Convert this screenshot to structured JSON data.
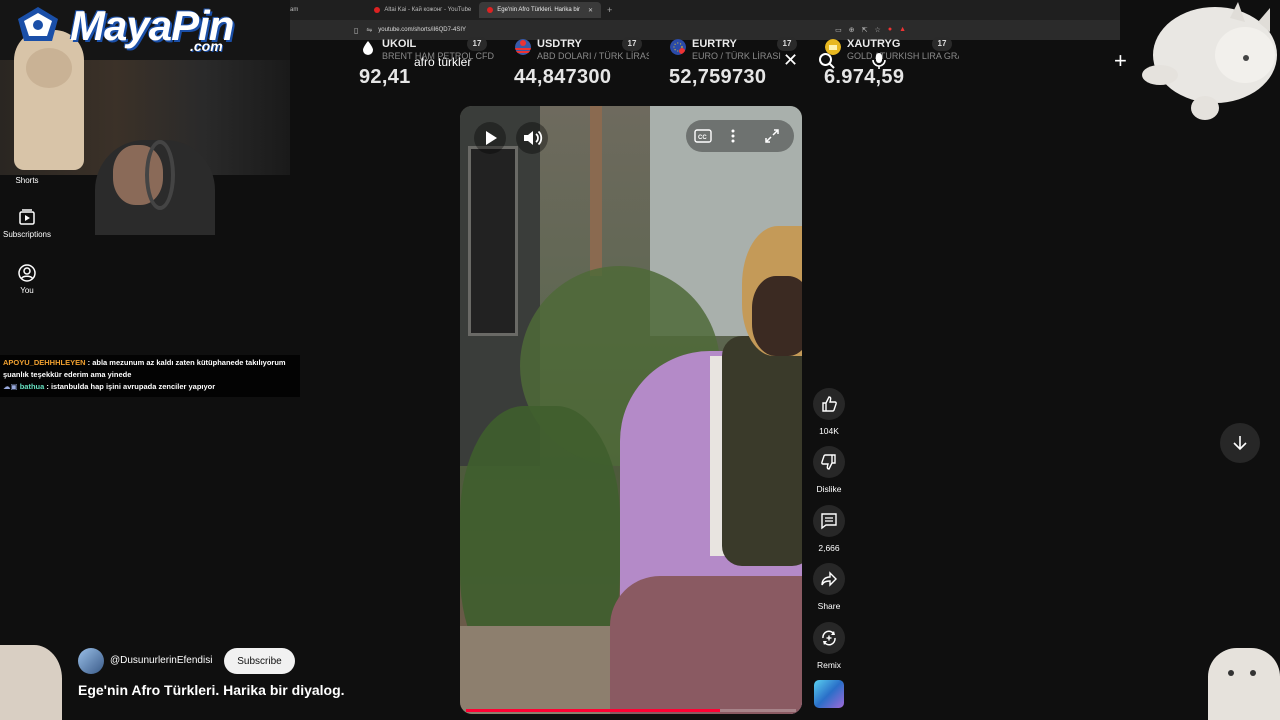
{
  "browser": {
    "tabs": [
      {
        "label": "ram",
        "active": false
      },
      {
        "label": "Altai Kai - Кай кожонг - YouTube",
        "active": false
      },
      {
        "label": "Ege'nin Afro Türkleri. Harika bir",
        "active": true
      }
    ],
    "url": "youtube.com/shorts/iI6QD7-4SIY"
  },
  "ticker": [
    {
      "symbol": "UKOIL",
      "desc": "BRENT HAM PETROL CFD'L",
      "value": "92,41"
    },
    {
      "symbol": "USDTRY",
      "desc": "ABD DOLARI / TÜRK LİRAS",
      "value": "44,847300"
    },
    {
      "symbol": "EURTRY",
      "desc": "EURO / TÜRK LİRASI",
      "value": "52,759730"
    },
    {
      "symbol": "XAUTRYG",
      "desc": "GOLD / TURKISH LIRA GRA",
      "value": "6.974,59"
    }
  ],
  "ticker_badge": "17",
  "search": {
    "query": "afro türkler"
  },
  "logo": {
    "main_white": "Maya",
    "main_blue": "Pin",
    "suffix": ".com"
  },
  "nav": {
    "shorts": "Shorts",
    "subscriptions": "Subscriptions",
    "you": "You"
  },
  "chat": [
    {
      "user": "APOYU_DEHHHLEYEN",
      "message": ": abla mezunum az kaldı zaten kütüphanede takılıyorum şuanlık teşekkür ederim ama yinede"
    },
    {
      "user": "bathua",
      "message": ": istanbulda hap işini avrupada zenciler yapıyor"
    }
  ],
  "actions": {
    "likes": "104K",
    "dislike": "Dislike",
    "comments": "2,666",
    "share": "Share",
    "remix": "Remix"
  },
  "video": {
    "channel": "@DusunurlerinEfendisi",
    "subscribe": "Subscribe",
    "title": "Ege'nin Afro Türkleri. Harika bir diyalog.",
    "progress": 0.77
  },
  "colors": {
    "background": "#0f0f0f",
    "accent_red": "#ff0033",
    "button_bg": "#272727",
    "chat_user1": "#f0a030",
    "chat_user2": "#66e0c0"
  }
}
